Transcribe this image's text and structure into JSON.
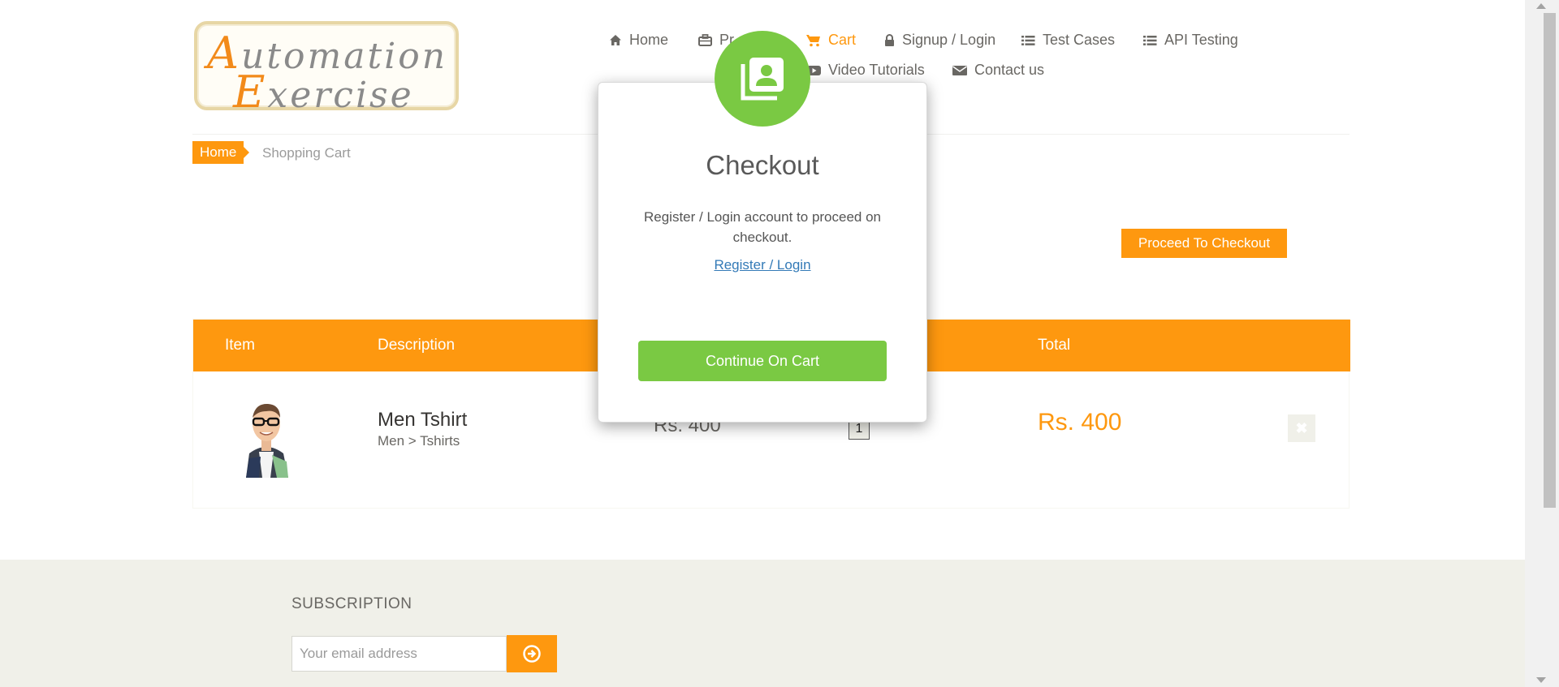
{
  "logo": {
    "line1_cap": "A",
    "line1_rest": "utomation",
    "line2_cap": "E",
    "line2_rest": "xercise"
  },
  "nav": [
    {
      "label": "Home",
      "icon": "home-icon"
    },
    {
      "label": "Pr",
      "icon": "briefcase-icon"
    },
    {
      "label": "Cart",
      "icon": "cart-icon",
      "active": true
    },
    {
      "label": "Signup / Login",
      "icon": "lock-icon"
    },
    {
      "label": "Test Cases",
      "icon": "list-icon"
    },
    {
      "label": "API Testing",
      "icon": "list-icon"
    },
    {
      "label": "Video Tutorials",
      "icon": "youtube-play-icon"
    },
    {
      "label": "Contact us",
      "icon": "envelope-icon"
    }
  ],
  "breadcrumb": {
    "home": "Home",
    "current": "Shopping Cart"
  },
  "proceed_button": "Proceed To Checkout",
  "cart": {
    "headers": [
      "Item",
      "Description",
      "Total"
    ],
    "rows": [
      {
        "name": "Men Tshirt",
        "category": "Men > Tshirts",
        "price": "Rs. 400",
        "quantity": "1",
        "total": "Rs. 400",
        "delete_icon": "close-icon"
      }
    ]
  },
  "footer": {
    "subscription_title": "SUBSCRIPTION",
    "email_placeholder": "Your email address",
    "subscribe_icon": "arrow-circle-right-icon"
  },
  "modal": {
    "icon": "contacts-book-icon",
    "title": "Checkout",
    "body": "Register / Login account to proceed on checkout.",
    "link": "Register / Login",
    "continue_button": "Continue On Cart"
  },
  "colors": {
    "accent": "#fe980f",
    "success": "#7ac943",
    "link": "#337ab7",
    "footer_bg": "#f0f0e9"
  }
}
